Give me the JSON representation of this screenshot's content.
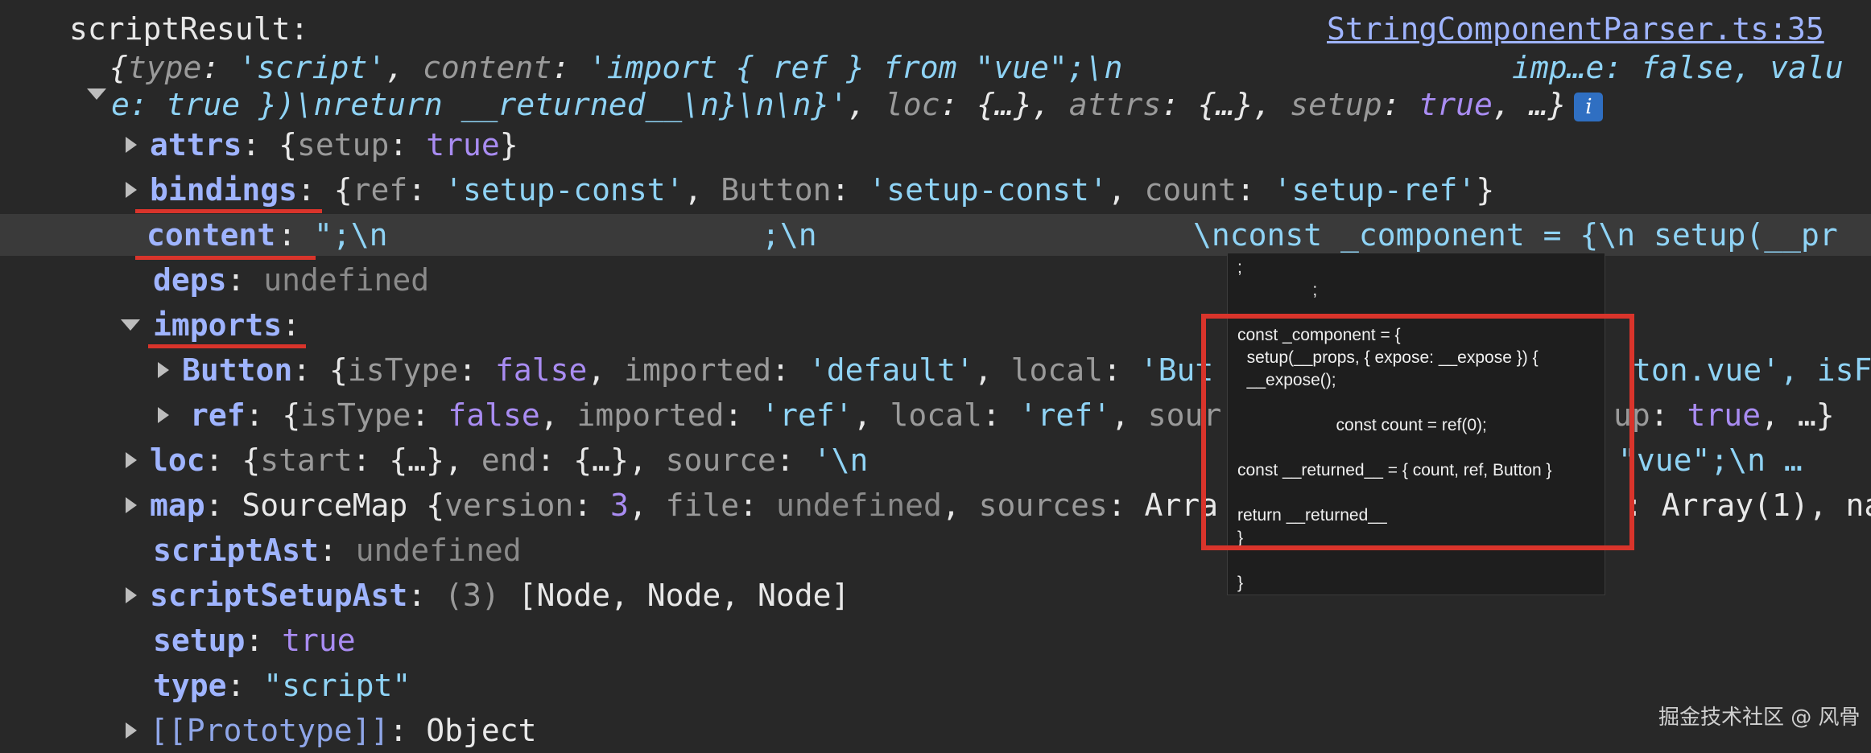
{
  "header": {
    "title": "scriptResult:",
    "source_link": "StringComponentParser.ts:35"
  },
  "preview": {
    "line1": {
      "open": "{",
      "k_type": "type",
      "v_type": "'script'",
      "k_content": "content",
      "v_content": "'import { ref } from \"vue\";\\n",
      "tail": "imp…e: false, valu"
    },
    "line2": {
      "cont": "e: true })\\nreturn __returned__\\n}\\n\\n}'",
      "k_loc": "loc",
      "v_loc": "{…}",
      "k_attrs": "attrs",
      "v_attrs": "{…}",
      "k_setup": "setup",
      "v_setup": "true",
      "rest": "…}",
      "info": "i"
    }
  },
  "props": {
    "attrs": {
      "key": "attrs",
      "k1": "setup",
      "v1": "true"
    },
    "bindings": {
      "key": "bindings",
      "k1": "ref",
      "v1": "'setup-const'",
      "k2": "Button",
      "v2": "'setup-const'",
      "k3": "count",
      "v3": "'setup-ref'"
    },
    "content": {
      "key": "content",
      "seg1": "\";\\n",
      "seg2": ";\\n",
      "seg3": "\\nconst _component = {\\n  setup(__pr"
    },
    "deps": {
      "key": "deps",
      "value": "undefined"
    },
    "imports": {
      "key": "imports"
    },
    "button": {
      "key": "Button",
      "k1": "isType",
      "v1": "false",
      "k2": "imported",
      "v2": "'default'",
      "k3": "local",
      "v3": "'But",
      "tail": "ton.vue', isFr"
    },
    "ref": {
      "key": "ref",
      "k1": "isType",
      "v1": "false",
      "k2": "imported",
      "v2": "'ref'",
      "k3": "local",
      "v3": "'ref'",
      "k4": "sour",
      "tail_key": "up",
      "tail_val": "true",
      "tail_rest": "…}"
    },
    "loc": {
      "key": "loc",
      "k1": "start",
      "v1": "{…}",
      "k2": "end",
      "v2": "{…}",
      "k3": "source",
      "v3": "'\\n",
      "tail": "\"vue\";\\n  …"
    },
    "map": {
      "key": "map",
      "cls": "SourceMap",
      "k1": "version",
      "v1": "3",
      "k2": "file",
      "v2": "undefined",
      "k3": "sources",
      "v3": "Arra",
      "tail": ": Array(1), na"
    },
    "scriptAst": {
      "key": "scriptAst",
      "value": "undefined"
    },
    "scriptSetupAst": {
      "key": "scriptSetupAst",
      "count": "(3)",
      "value": "[Node, Node, Node]"
    },
    "setup": {
      "key": "setup",
      "value": "true"
    },
    "type": {
      "key": "type",
      "value": "\"script\""
    },
    "prototype": {
      "key": "[[Prototype]]",
      "value": "Object"
    }
  },
  "tooltip": {
    "lines": [
      ";",
      "                ;",
      "",
      "const _component = {",
      "  setup(__props, { expose: __expose }) {",
      "  __expose();",
      "",
      "                     const count = ref(0);",
      "",
      "const __returned__ = { count, ref, Button }",
      "",
      "return __returned__",
      "}",
      "",
      "}"
    ]
  },
  "watermark": "掘金技术社区 @ 风骨",
  "colors": {
    "background": "#282828",
    "key": "#9fb4ff",
    "string": "#8fd3f5",
    "keyword": "#a98cf2",
    "annotation": "#d9342b"
  }
}
